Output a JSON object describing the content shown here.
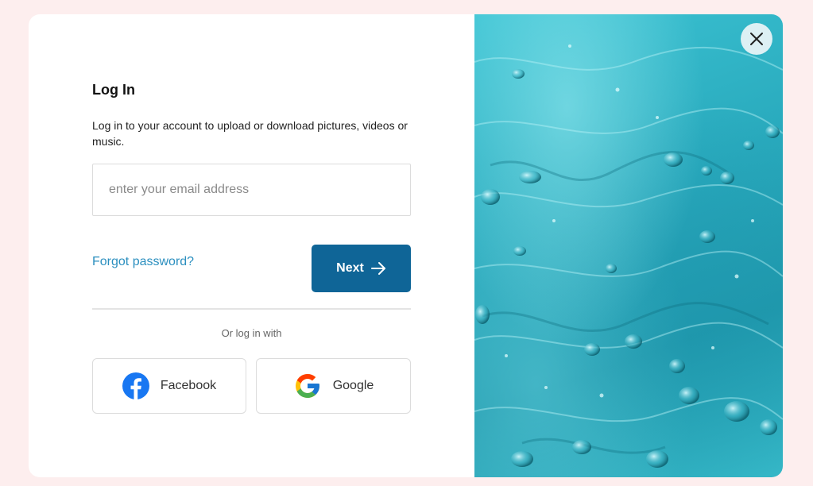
{
  "login": {
    "title": "Log In",
    "subtitle": "Log in to your account to upload or download pictures, videos or music.",
    "email_placeholder": "enter your email address",
    "email_value": "",
    "forgot_password": "Forgot password?",
    "next_label": "Next",
    "next_icon": "arrow-right-icon",
    "or_text": "Or log in with",
    "social": {
      "facebook_label": "Facebook",
      "facebook_icon": "facebook-icon",
      "google_label": "Google",
      "google_icon": "google-icon"
    }
  },
  "close_icon": "close-icon",
  "hero_image": "water-surface-image",
  "colors": {
    "background": "#fdeeee",
    "primary_button": "#0f6597",
    "link": "#2b8fbf",
    "facebook_blue": "#1877f2",
    "water": "#2eb2c4"
  }
}
